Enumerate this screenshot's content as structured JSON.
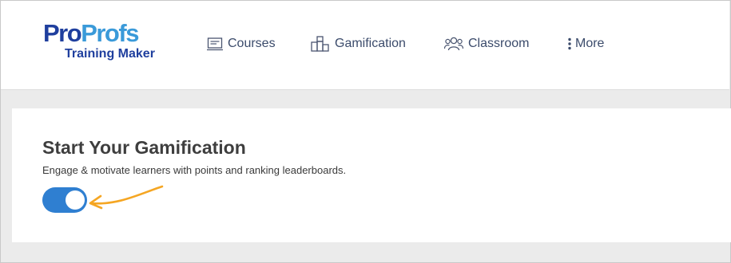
{
  "brand": {
    "logo_part1": "Pro",
    "logo_part2": "Profs",
    "logo_sub": "Training Maker",
    "colors": {
      "dark_blue": "#1f3f9e",
      "light_blue": "#3a9ad9"
    }
  },
  "nav": {
    "items": [
      {
        "label": "Courses",
        "icon": "courses-icon"
      },
      {
        "label": "Gamification",
        "icon": "gamification-icon"
      },
      {
        "label": "Classroom",
        "icon": "classroom-icon"
      },
      {
        "label": "More",
        "icon": "more-vertical-icon"
      }
    ]
  },
  "card": {
    "title": "Start Your Gamification",
    "subtitle": "Engage & motivate learners with points and ranking leaderboards.",
    "toggle_on": true,
    "toggle_color": "#2f7fd1",
    "annotation_arrow_color": "#f5a623"
  }
}
